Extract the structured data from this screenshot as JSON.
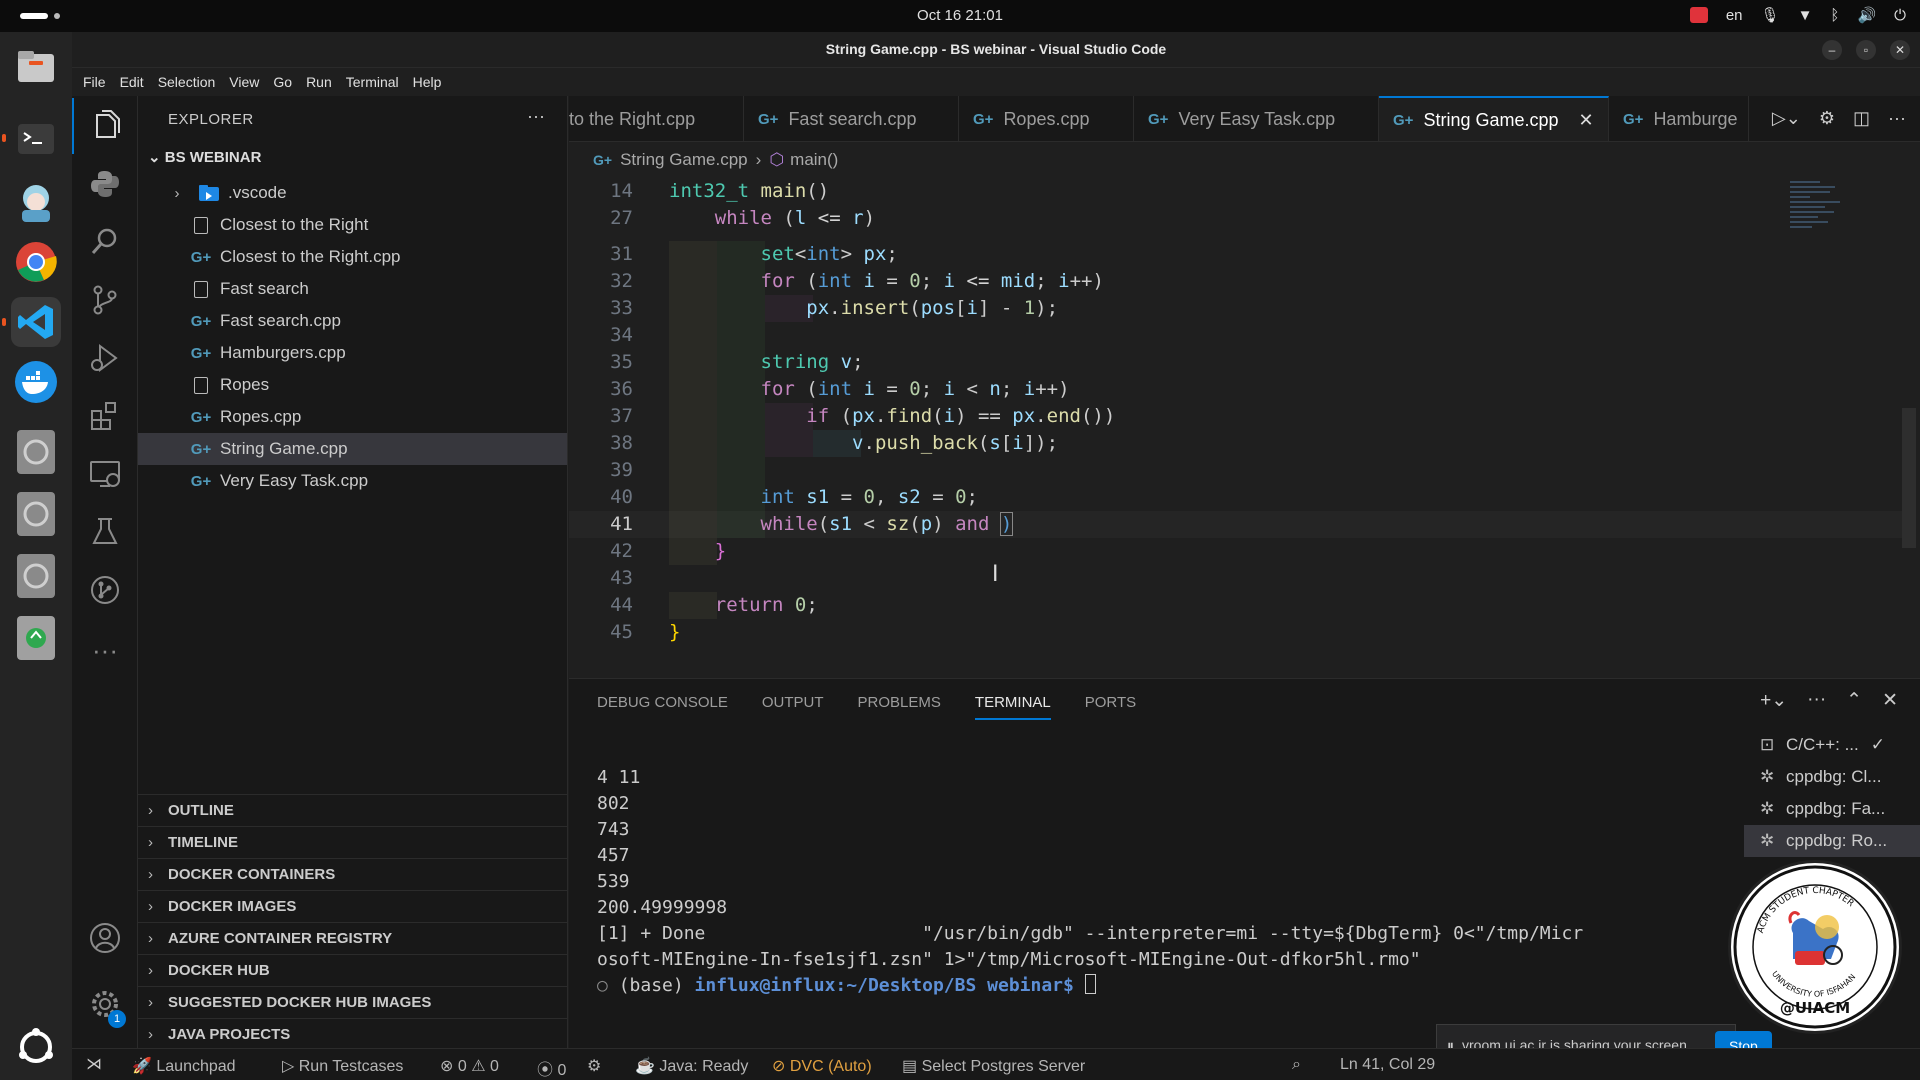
{
  "topbar": {
    "clock": "Oct 16  21:01",
    "language": "en"
  },
  "window": {
    "title": "String Game.cpp - BS webinar - Visual Studio Code"
  },
  "menu": [
    "File",
    "Edit",
    "Selection",
    "View",
    "Go",
    "Run",
    "Terminal",
    "Help"
  ],
  "sidebar": {
    "header": "EXPLORER",
    "more": "···",
    "folder": "BS WEBINAR",
    "items": [
      {
        "label": ".vscode",
        "kind": "folder"
      },
      {
        "label": "Closest to the Right",
        "kind": "file"
      },
      {
        "label": "Closest to the Right.cpp",
        "kind": "cpp"
      },
      {
        "label": "Fast search",
        "kind": "file"
      },
      {
        "label": "Fast search.cpp",
        "kind": "cpp"
      },
      {
        "label": "Hamburgers.cpp",
        "kind": "cpp"
      },
      {
        "label": "Ropes",
        "kind": "file"
      },
      {
        "label": "Ropes.cpp",
        "kind": "cpp"
      },
      {
        "label": "String Game.cpp",
        "kind": "cpp",
        "selected": true
      },
      {
        "label": "Very Easy Task.cpp",
        "kind": "cpp"
      }
    ],
    "sections": [
      "OUTLINE",
      "TIMELINE",
      "DOCKER CONTAINERS",
      "DOCKER IMAGES",
      "AZURE CONTAINER REGISTRY",
      "DOCKER HUB",
      "SUGGESTED DOCKER HUB IMAGES",
      "JAVA PROJECTS"
    ]
  },
  "tabs": [
    {
      "label": "to the Right.cpp"
    },
    {
      "label": "Fast search.cpp"
    },
    {
      "label": "Ropes.cpp"
    },
    {
      "label": "Very Easy Task.cpp"
    },
    {
      "label": "String Game.cpp",
      "active": true
    },
    {
      "label": "Hamburge"
    }
  ],
  "breadcrumb": {
    "file": "String Game.cpp",
    "symbol": "main()"
  },
  "editor": {
    "line_numbers": [
      "14",
      "27",
      "31",
      "32",
      "33",
      "34",
      "35",
      "36",
      "37",
      "38",
      "39",
      "40",
      "41",
      "42",
      "43",
      "44",
      "45"
    ],
    "cursor_line": "41"
  },
  "panel": {
    "tabs": [
      "DEBUG CONSOLE",
      "OUTPUT",
      "PROBLEMS",
      "TERMINAL",
      "PORTS"
    ],
    "active_tab": "TERMINAL",
    "terminal_lines": [
      "4 11",
      "802",
      "743",
      "457",
      "539",
      "200.49999998",
      "[1] + Done                    \"/usr/bin/gdb\" --interpreter=mi --tty=${DbgTerm} 0<\"/tmp/Micr",
      "osoft-MIEngine-In-fse1sjf1.zsn\" 1>\"/tmp/Microsoft-MIEngine-Out-dfkor5hl.rmo\""
    ],
    "prompt_prefix": "(base) ",
    "prompt_user": "influx@influx:~/Desktop/BS webinar$",
    "terminals": [
      {
        "label": "C/C++: ...",
        "icon": "terminal-icon"
      },
      {
        "label": "cppdbg: Cl...",
        "icon": "debug-icon"
      },
      {
        "label": "cppdbg: Fa...",
        "icon": "debug-icon"
      },
      {
        "label": "cppdbg: Ro...",
        "icon": "debug-icon",
        "active": true
      }
    ]
  },
  "notification": {
    "text": "vroom.ui.ac.ir is sharing your screen.",
    "button": "Stop"
  },
  "statusbar": {
    "launchpad": "Launchpad",
    "run_testcases": "Run Testcases",
    "errors": "0",
    "warnings": "0",
    "ports": "0",
    "java": "Java: Ready",
    "dvc": "DVC (Auto)",
    "postgres": "Select Postgres Server",
    "position": "Ln 41, Col 29"
  },
  "seal": {
    "text": "@UIACM",
    "ring_text": "ACM STUDENT CHAPTER · UNIVERSITY OF ISFAHAN"
  },
  "accent": "#0078d4"
}
